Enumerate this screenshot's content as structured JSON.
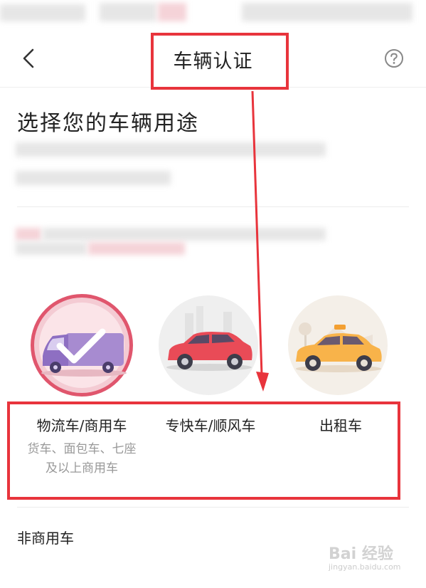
{
  "nav": {
    "title": "车辆认证",
    "back_icon": "chevron-left-icon",
    "help_icon": "question-circle-icon"
  },
  "section": {
    "title": "选择您的车辆用途"
  },
  "vehicle_options": [
    {
      "label": "物流车/商用车",
      "description_line1": "货车、面包车、七座",
      "description_line2": "及以上商用车",
      "selected": true,
      "icon": "van-icon"
    },
    {
      "label": "专快车/顺风车",
      "selected": false,
      "icon": "suv-car-icon"
    },
    {
      "label": "出租车",
      "selected": false,
      "icon": "taxi-icon"
    }
  ],
  "non_commercial": {
    "label": "非商用车"
  },
  "watermark": {
    "text": "Bai 经验",
    "sub": "jingyan.baidu.com"
  },
  "colors": {
    "highlight": "#e8343c",
    "selected_ring": "#e0566d",
    "check": "#ffffff",
    "text_primary": "#222222",
    "text_secondary": "#999999"
  }
}
